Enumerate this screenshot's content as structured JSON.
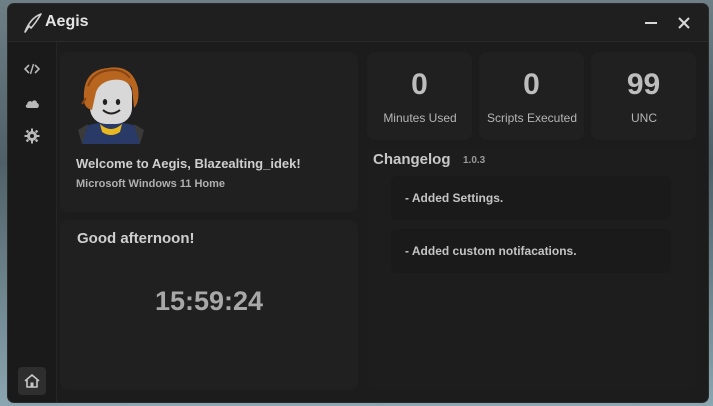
{
  "window": {
    "title": "Aegis"
  },
  "profile": {
    "welcome": "Welcome to Aegis, Blazealting_idek!",
    "os": "Microsoft Windows 11 Home",
    "greeting": "Good afternoon!",
    "clock": "15:59:24"
  },
  "stats": [
    {
      "value": "0",
      "label": "Minutes Used"
    },
    {
      "value": "0",
      "label": "Scripts Executed"
    },
    {
      "value": "99",
      "label": "UNC"
    }
  ],
  "changelog": {
    "title": "Changelog",
    "version": "1.0.3",
    "items": [
      "- Added Settings.",
      "- Added custom notifacations."
    ]
  },
  "sidebar": {
    "icons": [
      "code-icon",
      "cloud-icon",
      "gear-icon",
      "home-icon"
    ]
  },
  "colors": {
    "window_bg": "#1c1c1c",
    "panel_bg": "#202020",
    "text_primary": "#cfcfcf",
    "text_muted": "#9a9a9a"
  }
}
